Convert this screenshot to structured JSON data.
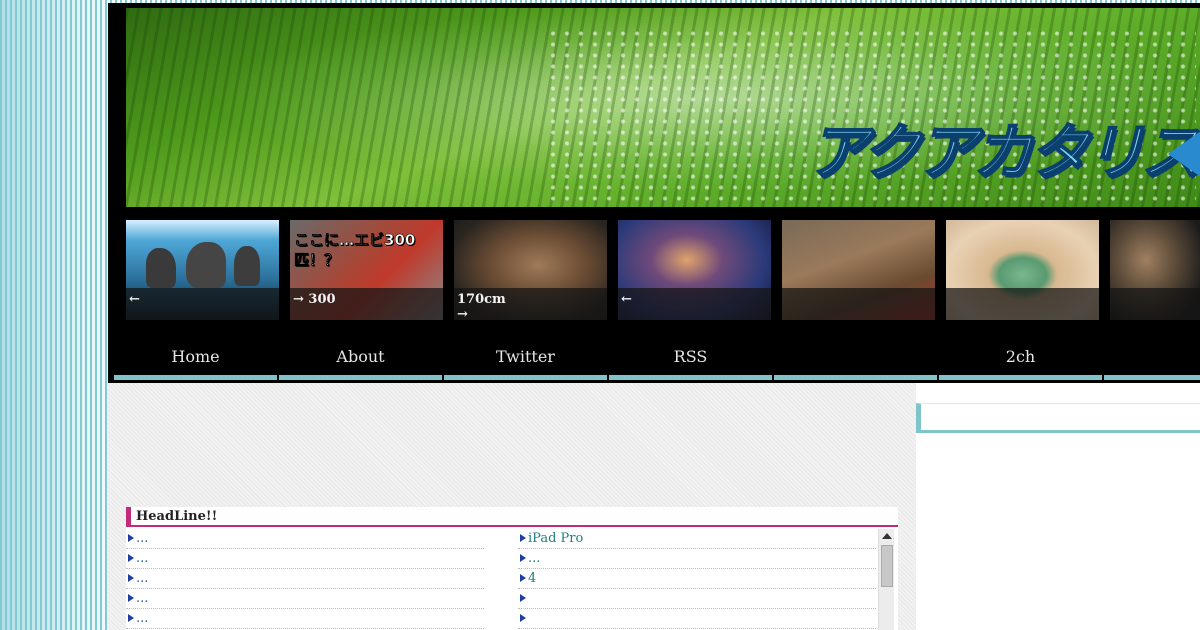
{
  "banner": {
    "logo_text": "アクアカタリスト"
  },
  "thumbnails": [
    {
      "caption": "←",
      "image": "aquascape-rock-tank"
    },
    {
      "caption": "→ 300",
      "image": "ebi-300-hiki-youtube-thumb",
      "overlay_text": "ここに…エビ300匹！？"
    },
    {
      "caption": "170cm\n→",
      "image": "stacked-rocks"
    },
    {
      "caption": "←",
      "image": "anemone"
    },
    {
      "caption": "",
      "image": "capybara-in-bath"
    },
    {
      "caption": "",
      "image": "green-frog"
    },
    {
      "caption": "",
      "image": "driftwood"
    }
  ],
  "nav": {
    "items": [
      {
        "label": "Home"
      },
      {
        "label": "About"
      },
      {
        "label": "Twitter"
      },
      {
        "label": "RSS"
      },
      {
        "label": ""
      },
      {
        "label": "2ch"
      },
      {
        "label": ""
      }
    ]
  },
  "headline": {
    "title": "HeadLine!!",
    "left_items": [
      "...",
      "...",
      "...",
      "...",
      "..."
    ],
    "right_items": [
      "iPad Pro",
      "...",
      "4",
      "",
      ""
    ]
  },
  "colors": {
    "nav_underline": "#7fc4c8",
    "headline_accent": "#c12b79",
    "link": "#1f5fa0"
  }
}
